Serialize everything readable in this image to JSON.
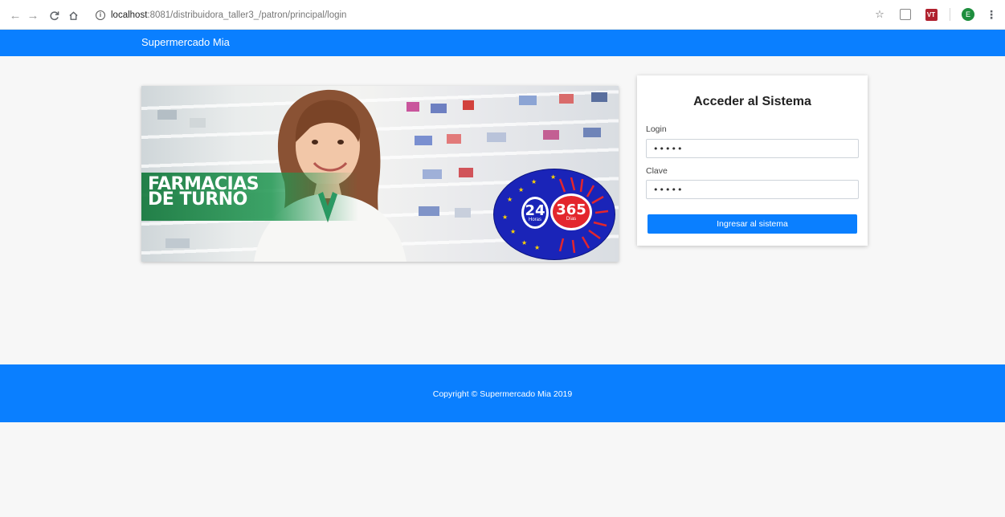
{
  "browser": {
    "url_host": "localhost",
    "url_rest": ":8081/distribuidora_taller3_/patron/principal/login",
    "avatar_letter": "E"
  },
  "navbar": {
    "brand": "Supermercado Mia"
  },
  "banner": {
    "line1": "FARMACIAS",
    "line2": "DE TURNO",
    "badge_hours_number": "24",
    "badge_hours_label": "Horas",
    "badge_days_number": "365",
    "badge_days_label": "Días"
  },
  "login": {
    "title": "Acceder al Sistema",
    "login_label": "Login",
    "login_value": "•••••",
    "password_label": "Clave",
    "password_value": "•••••",
    "submit_label": "Ingresar al sistema"
  },
  "footer": {
    "copyright": "Copyright © Supermercado Mia 2019"
  },
  "colors": {
    "primary": "#0a7fff",
    "background": "#f7f7f7",
    "banner_green": "#1e9650",
    "badge_blue": "#1a24b8",
    "badge_red": "#e3262d"
  }
}
